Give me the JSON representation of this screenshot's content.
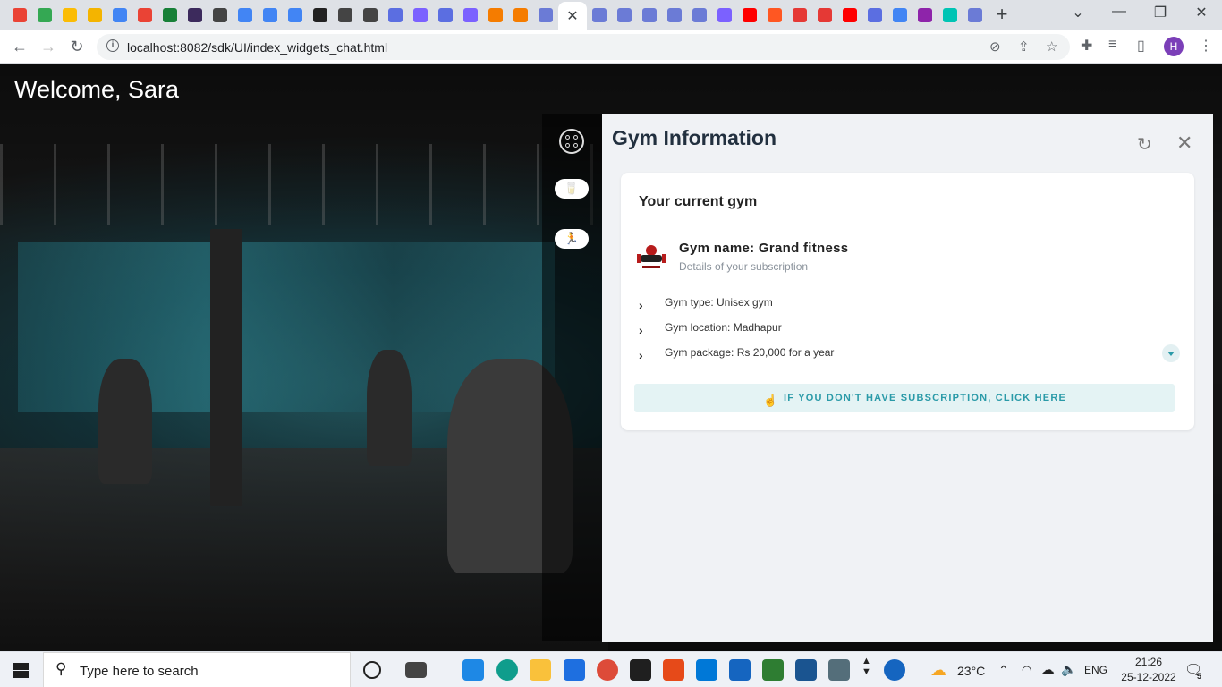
{
  "browser": {
    "active_tab_close": "✕",
    "new_tab": "+",
    "favicon_colors": [
      "#ea4335",
      "#34a853",
      "#fbbc05",
      "#f4b400",
      "#4285f4",
      "#ea4335",
      "#188038",
      "#3c2a5c",
      "#444",
      "#4285f4",
      "#4285f4",
      "#4285f4",
      "#222",
      "#444",
      "#444",
      "#5b6ee1",
      "#7b61ff",
      "#5b6ee1",
      "#7b61ff",
      "#f57c00",
      "#f57c00",
      "#6b7bd6"
    ],
    "favicon_colors_right": [
      "#6b7bd6",
      "#6b7bd6",
      "#6b7bd6",
      "#6b7bd6",
      "#6b7bd6",
      "#7b61ff",
      "#ff0000",
      "#ff5722",
      "#e53935",
      "#e53935",
      "#ff0000",
      "#5b6ee1",
      "#4285f4",
      "#8e24aa",
      "#00c4b4",
      "#6b7bd6"
    ],
    "url": "localhost:8082/sdk/UI/index_widgets_chat.html",
    "profile_initial": "H"
  },
  "page": {
    "welcome": "Welcome, Sara"
  },
  "panel": {
    "title": "Gym Information",
    "card_heading": "Your current gym",
    "gym_name": "Gym name: Grand fitness",
    "gym_sub": "Details of your subscription",
    "rows": [
      {
        "label": "Gym type: Unisex gym"
      },
      {
        "label": "Gym location: Madhapur"
      },
      {
        "label": "Gym package: Rs 20,000 for a year"
      }
    ],
    "subscription_button": "IF YOU DON'T HAVE SUBSCRIPTION, CLICK HERE",
    "accent": "#2a9aa8"
  },
  "taskbar": {
    "search_placeholder": "Type here to search",
    "weather": "23°C",
    "language": "ENG",
    "time": "21:26",
    "date": "25-12-2022",
    "notifications": "5"
  }
}
